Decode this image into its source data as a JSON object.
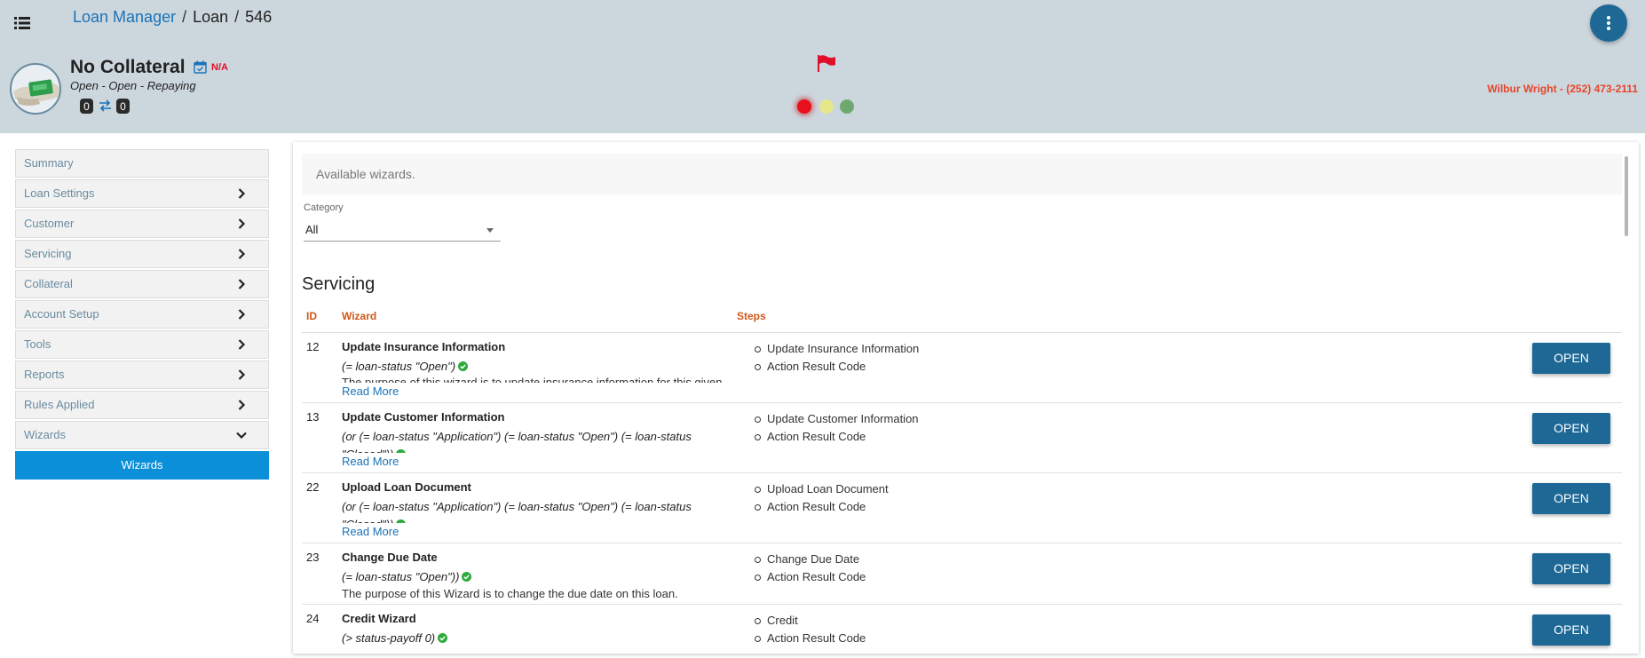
{
  "breadcrumb": {
    "app": "Loan Manager",
    "section": "Loan",
    "id": "546",
    "separator": "/"
  },
  "loan": {
    "title": "No Collateral",
    "badge": "N/A",
    "status": "Open - Open - Repaying",
    "count_left": "0",
    "count_right": "0"
  },
  "status_lights": {
    "red": "#e8101c",
    "yellow": "#e6e68a",
    "green": "#6fa86f"
  },
  "contact": "Wilbur Wright - (252) 473-2111",
  "sidebar": {
    "items": [
      {
        "label": "Summary",
        "icon": "none"
      },
      {
        "label": "Loan Settings",
        "icon": "chevron-right-icon"
      },
      {
        "label": "Customer",
        "icon": "chevron-right-icon"
      },
      {
        "label": "Servicing",
        "icon": "chevron-right-icon"
      },
      {
        "label": "Collateral",
        "icon": "chevron-right-icon"
      },
      {
        "label": "Account Setup",
        "icon": "chevron-right-icon"
      },
      {
        "label": "Tools",
        "icon": "chevron-right-icon"
      },
      {
        "label": "Reports",
        "icon": "chevron-right-icon"
      },
      {
        "label": "Rules Applied",
        "icon": "chevron-right-icon"
      },
      {
        "label": "Wizards",
        "icon": "chevron-down-icon"
      }
    ],
    "active": "Wizards"
  },
  "main": {
    "intro": "Available wizards.",
    "category_label": "Category",
    "category_value": "All",
    "section_title": "Servicing",
    "columns": {
      "id": "ID",
      "wizard": "Wizard",
      "steps": "Steps"
    },
    "open_label": "OPEN",
    "read_more": "Read More",
    "rows": [
      {
        "id": "12",
        "name": "Update Insurance Information",
        "condition": "(= loan-status \"Open\")",
        "description": "The purpose of this wizard is to update insurance information for this given",
        "steps": [
          "Update Insurance Information",
          "Action Result Code"
        ]
      },
      {
        "id": "13",
        "name": "Update Customer Information",
        "condition": "(or (= loan-status \"Application\") (= loan-status \"Open\") (= loan-status \"Closed\"))",
        "steps": [
          "Update Customer Information",
          "Action Result Code"
        ]
      },
      {
        "id": "22",
        "name": "Upload Loan Document",
        "condition": "(or (= loan-status \"Application\") (= loan-status \"Open\") (= loan-status \"Closed\"))",
        "steps": [
          "Upload Loan Document",
          "Action Result Code"
        ]
      },
      {
        "id": "23",
        "name": "Change Due Date",
        "condition": "(= loan-status \"Open\"))",
        "description": "The purpose of this Wizard is to change the due date on this loan.",
        "steps": [
          "Change Due Date",
          "Action Result Code"
        ]
      },
      {
        "id": "24",
        "name": "Credit Wizard",
        "condition": "(> status-payoff 0)",
        "steps": [
          "Credit",
          "Action Result Code"
        ]
      }
    ]
  }
}
